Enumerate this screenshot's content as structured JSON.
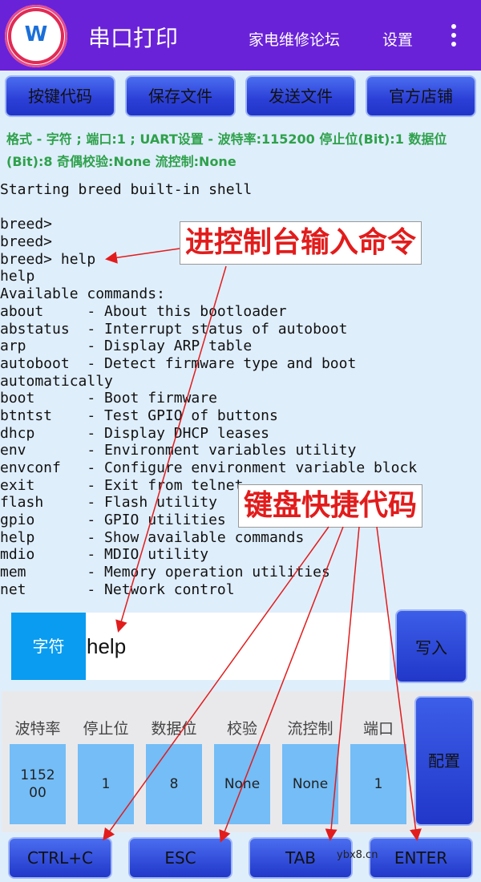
{
  "appbar": {
    "title": "串口打印",
    "forum_label": "家电维修论坛",
    "settings_label": "设置",
    "menu_icon": "more-vert-icon",
    "logo_text": "W"
  },
  "top_buttons": [
    "按键代码",
    "保存文件",
    "发送文件",
    "官方店铺"
  ],
  "format_line": "格式 - 字符 ; 端口:1 ; UART设置 - 波特率:115200 停止位(Bit):1 数据位(Bit):8 奇偶校验:None 流控制:None",
  "console_lines": [
    "Starting breed built-in shell",
    "",
    "breed>",
    "breed>",
    "breed> help",
    "help",
    "Available commands:",
    "about     - About this bootloader",
    "abstatus  - Interrupt status of autoboot",
    "arp       - Display ARP table",
    "autoboot  - Detect firmware type and boot",
    "automatically",
    "boot      - Boot firmware",
    "btntst    - Test GPIO of buttons",
    "dhcp      - Display DHCP leases",
    "env       - Environment variables utility",
    "envconf   - Configure environment variable block",
    "exit      - Exit from telnet",
    "flash     - Flash utility",
    "gpio      - GPIO utilities",
    "help      - Show available commands",
    "mdio      - MDIO utility",
    "mem       - Memory operation utilities",
    "net       - Network control"
  ],
  "annotations": {
    "console_hint": "进控制台输入命令",
    "keys_hint": "键盘快捷代码"
  },
  "input": {
    "mode_label": "字符",
    "value": "help",
    "write_label": "写入"
  },
  "settings": {
    "columns": [
      {
        "label": "波特率",
        "value": "115200"
      },
      {
        "label": "停止位",
        "value": "1"
      },
      {
        "label": "数据位",
        "value": "8"
      },
      {
        "label": "校验",
        "value": "None"
      },
      {
        "label": "流控制",
        "value": "None"
      },
      {
        "label": "端口",
        "value": "1"
      }
    ],
    "config_label": "配置"
  },
  "key_buttons": [
    "CTRL+C",
    "ESC",
    "TAB",
    "ENTER"
  ],
  "watermark": "ybx8.cn",
  "colors": {
    "appbar": "#6a22d8",
    "button": "#2b3ed6",
    "format_text": "#2ea14b",
    "annotation_text": "#e21c1c",
    "mode_label_bg": "#0a9cf0",
    "setting_value_bg": "#74bdf7"
  }
}
